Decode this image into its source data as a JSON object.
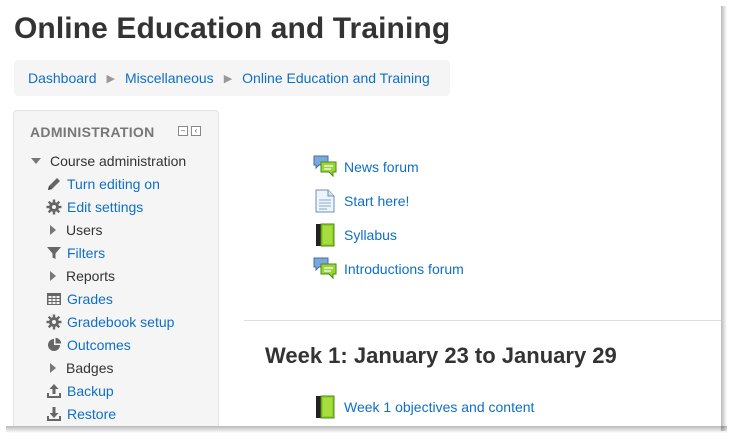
{
  "page": {
    "title": "Online Education and Training"
  },
  "breadcrumb": [
    {
      "label": "Dashboard"
    },
    {
      "label": "Miscellaneous"
    },
    {
      "label": "Online Education and Training"
    }
  ],
  "admin": {
    "title": "ADMINISTRATION",
    "items": [
      {
        "label": "Course administration",
        "icon": "caret-down-icon",
        "link": false
      },
      {
        "label": "Turn editing on",
        "icon": "pencil-icon",
        "link": true
      },
      {
        "label": "Edit settings",
        "icon": "gear-icon",
        "link": true
      },
      {
        "label": "Users",
        "icon": "caret-right-icon",
        "link": false
      },
      {
        "label": "Filters",
        "icon": "filter-icon",
        "link": true
      },
      {
        "label": "Reports",
        "icon": "caret-right-icon",
        "link": false
      },
      {
        "label": "Grades",
        "icon": "grades-table-icon",
        "link": true
      },
      {
        "label": "Gradebook setup",
        "icon": "gear-icon",
        "link": true
      },
      {
        "label": "Outcomes",
        "icon": "outcomes-icon",
        "link": true
      },
      {
        "label": "Badges",
        "icon": "caret-right-icon",
        "link": false
      },
      {
        "label": "Backup",
        "icon": "upload-icon",
        "link": true
      },
      {
        "label": "Restore",
        "icon": "download-icon",
        "link": true
      }
    ]
  },
  "activities": [
    {
      "label": "News forum",
      "icon": "forum-icon"
    },
    {
      "label": "Start here!",
      "icon": "page-icon"
    },
    {
      "label": "Syllabus",
      "icon": "book-icon"
    },
    {
      "label": "Introductions forum",
      "icon": "forum-icon"
    }
  ],
  "week1": {
    "title": "Week 1: January 23 to January 29",
    "activities": [
      {
        "label": "Week 1 objectives and content",
        "icon": "book-icon"
      }
    ]
  }
}
